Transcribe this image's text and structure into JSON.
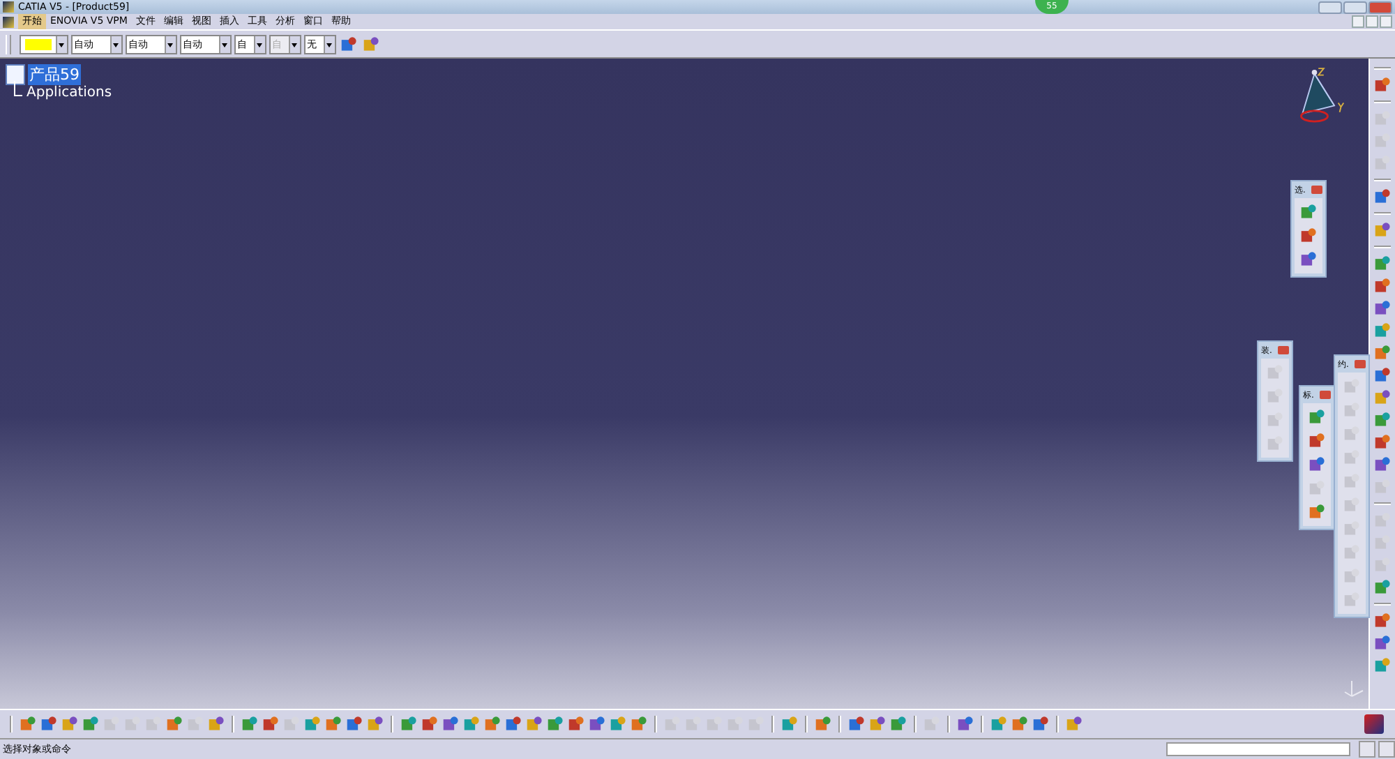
{
  "window": {
    "title": "CATIA V5 - [Product59]"
  },
  "badge": "55",
  "menu": [
    {
      "label": "开始",
      "selected": true
    },
    {
      "label": "ENOVIA V5 VPM",
      "selected": false
    },
    {
      "label": "文件",
      "selected": false
    },
    {
      "label": "编辑",
      "selected": false
    },
    {
      "label": "视图",
      "selected": false
    },
    {
      "label": "插入",
      "selected": false
    },
    {
      "label": "工具",
      "selected": false
    },
    {
      "label": "分析",
      "selected": false
    },
    {
      "label": "窗口",
      "selected": false
    },
    {
      "label": "帮助",
      "selected": false
    }
  ],
  "format_toolbar": {
    "fields": [
      {
        "kind": "color",
        "disabled": false
      },
      {
        "kind": "text",
        "value": "自动",
        "disabled": false
      },
      {
        "kind": "text",
        "value": "自动",
        "disabled": false
      },
      {
        "kind": "text",
        "value": "自动",
        "disabled": false
      },
      {
        "kind": "text",
        "value": "自",
        "disabled": false
      },
      {
        "kind": "text",
        "value": "自",
        "disabled": true
      },
      {
        "kind": "text",
        "value": "无",
        "disabled": false
      }
    ],
    "buttons": [
      {
        "disabled": false
      },
      {
        "disabled": false
      }
    ]
  },
  "tree": {
    "label": "产品59",
    "selected": true,
    "children": [
      {
        "label": "Applications",
        "selected": false
      }
    ]
  },
  "floating_toolbars": [
    {
      "title": "选.",
      "buttons": [
        {
          "disabled": false
        },
        {
          "disabled": false
        },
        {
          "disabled": false
        }
      ]
    },
    {
      "title": "装.",
      "buttons": [
        {
          "disabled": true
        },
        {
          "disabled": true
        },
        {
          "disabled": true
        },
        {
          "disabled": true
        }
      ]
    },
    {
      "title": "标.",
      "buttons": [
        {
          "disabled": false
        },
        {
          "disabled": false
        },
        {
          "disabled": false
        },
        {
          "disabled": true
        },
        {
          "disabled": false
        }
      ]
    },
    {
      "title": "约.",
      "buttons": [
        {
          "disabled": true
        },
        {
          "disabled": true
        },
        {
          "disabled": true
        },
        {
          "disabled": true
        },
        {
          "disabled": true
        },
        {
          "disabled": true
        },
        {
          "disabled": true
        },
        {
          "disabled": true
        },
        {
          "disabled": true
        },
        {
          "disabled": true
        }
      ]
    }
  ],
  "right_toolbar": [
    [
      {
        "disabled": false
      }
    ],
    [
      {
        "disabled": true
      },
      {
        "disabled": true
      },
      {
        "disabled": true
      }
    ],
    [
      {
        "disabled": false
      }
    ],
    [
      {
        "disabled": false
      }
    ],
    [
      {
        "disabled": false
      },
      {
        "disabled": false
      },
      {
        "disabled": false
      },
      {
        "disabled": false
      },
      {
        "disabled": false
      },
      {
        "disabled": false
      },
      {
        "disabled": false
      },
      {
        "disabled": false
      },
      {
        "disabled": false
      },
      {
        "disabled": false
      },
      {
        "disabled": true
      }
    ],
    [
      {
        "disabled": true
      },
      {
        "disabled": true
      },
      {
        "disabled": true
      },
      {
        "disabled": false
      }
    ],
    [
      {
        "disabled": false
      },
      {
        "disabled": false
      },
      {
        "disabled": false
      }
    ]
  ],
  "bottom_toolbar": [
    [
      {
        "disabled": false
      },
      {
        "disabled": false
      },
      {
        "disabled": false
      },
      {
        "disabled": false
      },
      {
        "disabled": true
      },
      {
        "disabled": true
      },
      {
        "disabled": true
      },
      {
        "disabled": false
      },
      {
        "disabled": true
      },
      {
        "disabled": false
      }
    ],
    [
      {
        "disabled": false
      },
      {
        "disabled": false
      },
      {
        "disabled": true
      },
      {
        "disabled": false
      },
      {
        "disabled": false
      },
      {
        "disabled": false
      },
      {
        "disabled": false
      }
    ],
    [
      {
        "disabled": false
      },
      {
        "disabled": false
      },
      {
        "disabled": false
      },
      {
        "disabled": false
      },
      {
        "disabled": false
      },
      {
        "disabled": false
      },
      {
        "disabled": false
      },
      {
        "disabled": false
      },
      {
        "disabled": false
      },
      {
        "disabled": false
      },
      {
        "disabled": false
      },
      {
        "disabled": false
      }
    ],
    [
      {
        "disabled": true
      },
      {
        "disabled": true
      },
      {
        "disabled": true
      },
      {
        "disabled": true
      },
      {
        "disabled": true
      }
    ],
    [
      {
        "disabled": false
      }
    ],
    [
      {
        "disabled": false
      }
    ],
    [
      {
        "disabled": false
      },
      {
        "disabled": false
      },
      {
        "disabled": false
      }
    ],
    [
      {
        "disabled": true
      }
    ],
    [
      {
        "disabled": false
      }
    ],
    [
      {
        "disabled": false
      },
      {
        "disabled": false
      },
      {
        "disabled": false
      }
    ],
    [
      {
        "disabled": false
      }
    ]
  ],
  "status_bar": {
    "message": "选择对象或命令"
  }
}
